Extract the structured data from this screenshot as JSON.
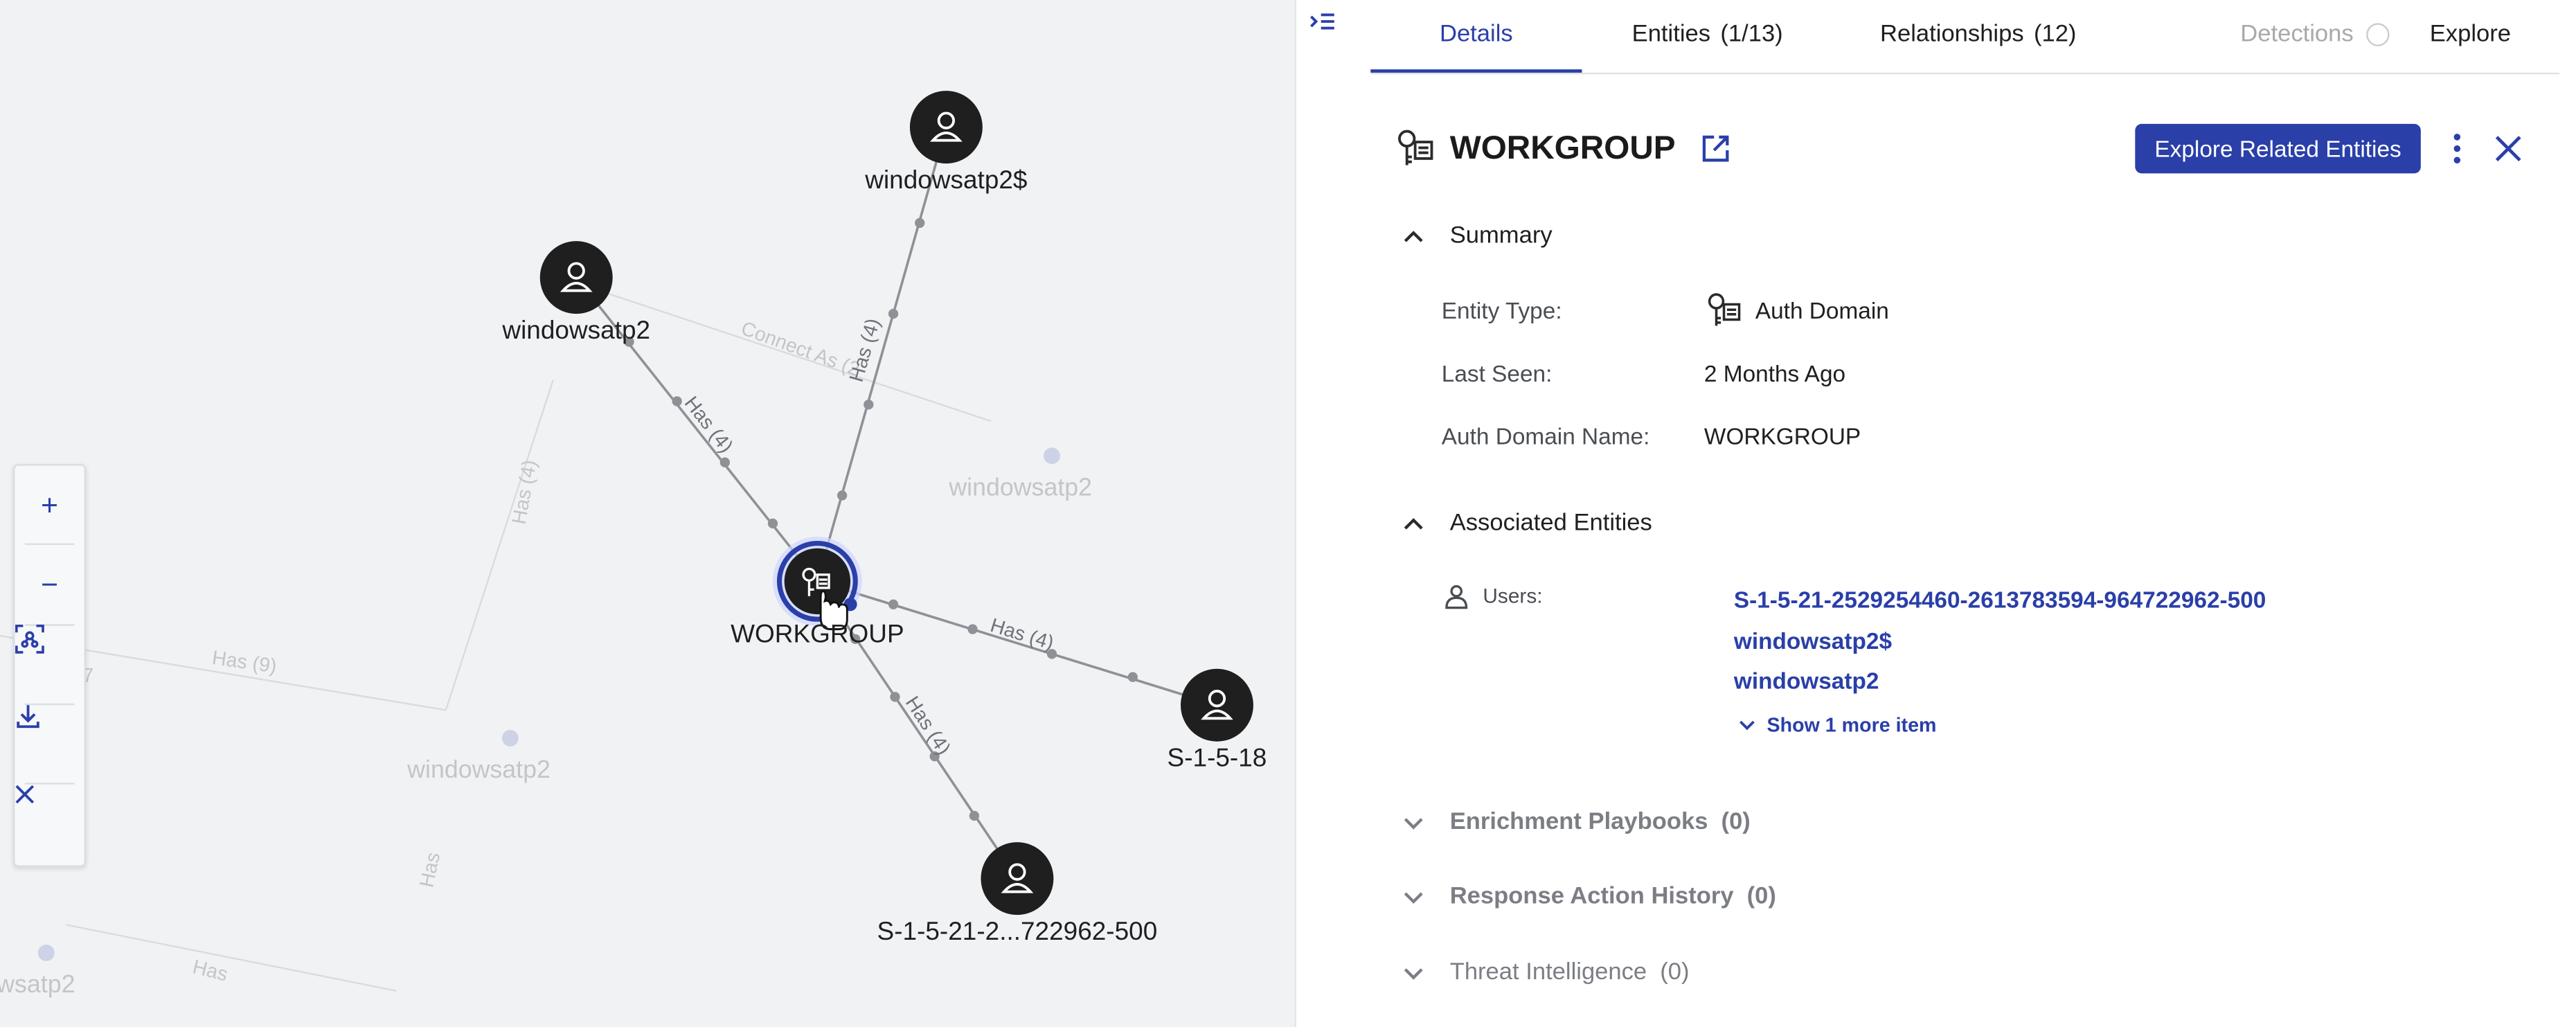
{
  "graph": {
    "nodes": [
      {
        "label": "windowsatp2$"
      },
      {
        "label": "windowsatp2"
      },
      {
        "label": "WORKGROUP"
      },
      {
        "label": "S-1-5-18"
      },
      {
        "label": "S-1-5-21-2...722962-500"
      }
    ],
    "edge_labels": [
      "Has (4)",
      "Has (4)",
      "Has (4)",
      "Has (4)"
    ],
    "faded_labels": [
      "Connect As (2",
      "Has (4)",
      "Has (9)",
      "windowsatp2",
      "windowsatp2",
      "Has",
      "Has",
      "wsatp2",
      "7"
    ],
    "zoom_controls": {
      "zoom_in": "+",
      "zoom_out": "−"
    }
  },
  "tabs": [
    {
      "label": "Details",
      "count": ""
    },
    {
      "label": "Entities",
      "count": "(1/13)"
    },
    {
      "label": "Relationships",
      "count": "(12)"
    },
    {
      "label": "Detections",
      "count": ""
    },
    {
      "label": "Explore",
      "count": ""
    }
  ],
  "entity": {
    "title": "WORKGROUP",
    "explore_button": "Explore Related Entities"
  },
  "summary": {
    "heading": "Summary",
    "rows": [
      {
        "label": "Entity Type:",
        "value": "Auth Domain"
      },
      {
        "label": "Last Seen:",
        "value": "2 Months Ago"
      },
      {
        "label": "Auth Domain Name:",
        "value": "WORKGROUP"
      }
    ]
  },
  "associated": {
    "heading": "Associated Entities",
    "users_label": "Users:",
    "users": [
      "S-1-5-21-2529254460-2613783594-964722962-500",
      "windowsatp2$",
      "windowsatp2"
    ],
    "show_more": "Show 1 more item"
  },
  "collapsed_sections": [
    {
      "label": "Enrichment Playbooks",
      "count": "(0)"
    },
    {
      "label": "Response Action History",
      "count": "(0)"
    },
    {
      "label": "Threat Intelligence",
      "count": "(0)"
    }
  ],
  "colors": {
    "accent": "#2a3fa8",
    "node": "#1f1f1f",
    "edge": "#8e9196",
    "canvas": "#f1f2f4"
  }
}
